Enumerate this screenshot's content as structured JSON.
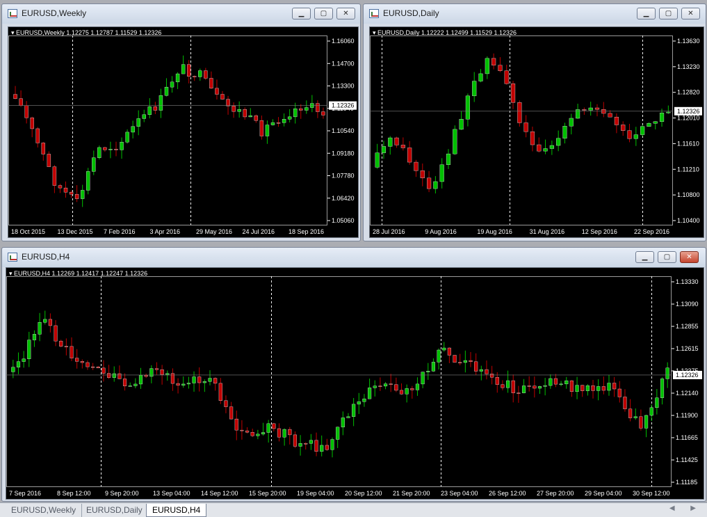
{
  "windows": {
    "weekly": {
      "title": "EURUSD,Weekly",
      "header": "EURUSD,Weekly  1.12275 1.12787 1.11529 1.12326",
      "price_labels": [
        "1.16060",
        "1.14700",
        "1.13300",
        "1.11940",
        "1.10540",
        "1.09180",
        "1.07780",
        "1.06420",
        "1.05060"
      ],
      "current_price": "1.12326",
      "date_labels": [
        "18 Oct 2015",
        "13 Dec 2015",
        "7 Feb 2016",
        "3 Apr 2016",
        "29 May 2016",
        "24 Jul 2016",
        "18 Sep 2016"
      ],
      "buttons": {
        "minimize": "▁",
        "maximize": "▢",
        "close": "✕"
      }
    },
    "daily": {
      "title": "EURUSD,Daily",
      "header": "EURUSD,Daily  1.12222 1.12499 1.11529 1.12326",
      "price_labels": [
        "1.13630",
        "1.13230",
        "1.12820",
        "1.12010",
        "1.11610",
        "1.11210",
        "1.10800",
        "1.10400"
      ],
      "current_price": "1.12326",
      "date_labels": [
        "28 Jul 2016",
        "9 Aug 2016",
        "19 Aug 2016",
        "31 Aug 2016",
        "12 Sep 2016",
        "22 Sep 2016"
      ],
      "buttons": {
        "minimize": "▁",
        "maximize": "▢",
        "close": "✕"
      }
    },
    "h4": {
      "title": "EURUSD,H4",
      "header": "EURUSD,H4  1.12269 1.12417 1.12247 1.12326",
      "price_labels": [
        "1.13330",
        "1.13090",
        "1.12855",
        "1.12615",
        "1.12375",
        "1.12140",
        "1.11900",
        "1.11665",
        "1.11425",
        "1.11185"
      ],
      "current_price": "1.12326",
      "date_labels": [
        "7 Sep 2016",
        "8 Sep 12:00",
        "9 Sep 20:00",
        "13 Sep 04:00",
        "14 Sep 12:00",
        "15 Sep 20:00",
        "19 Sep 04:00",
        "20 Sep 12:00",
        "21 Sep 20:00",
        "23 Sep 04:00",
        "26 Sep 12:00",
        "27 Sep 20:00",
        "29 Sep 04:00",
        "30 Sep 12:00"
      ],
      "buttons": {
        "minimize": "▁",
        "maximize": "▢",
        "close": "✕"
      }
    }
  },
  "tabs": [
    "EURUSD,Weekly",
    "EURUSD,Daily",
    "EURUSD,H4"
  ],
  "active_tab": "EURUSD,H4",
  "tab_arrows": "◀ ▶",
  "colors": {
    "bull": "#00c000",
    "bear": "#c00000",
    "grid": "#ffffff",
    "background": "#000000",
    "axis_text": "#ffffff"
  },
  "icons": [
    "chart-window-icon",
    "minimize-icon",
    "maximize-icon",
    "close-icon",
    "dropdown-triangle-icon"
  ]
}
